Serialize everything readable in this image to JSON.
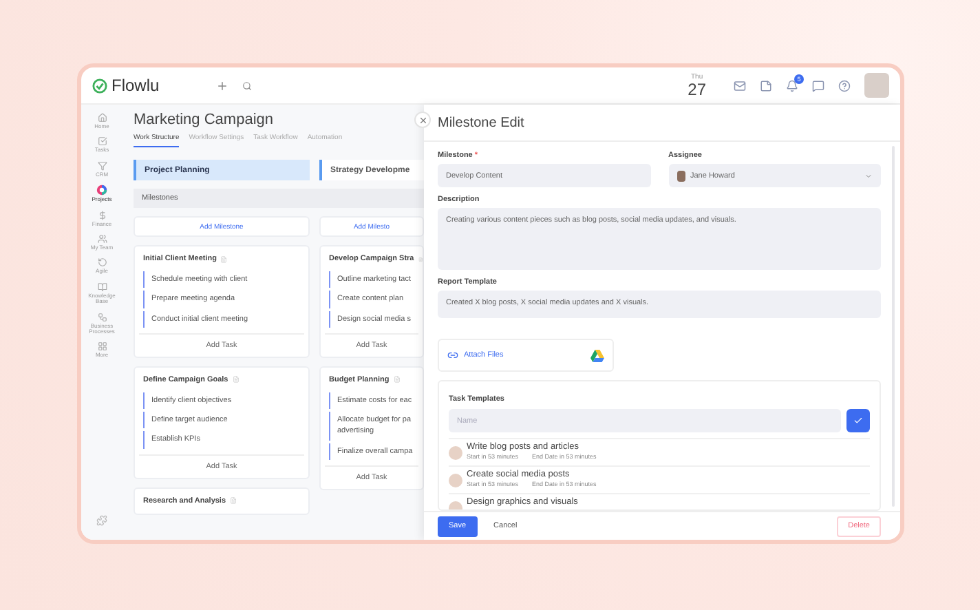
{
  "app": {
    "logo": "Flowlu"
  },
  "date": {
    "weekday": "Thu",
    "day": "27"
  },
  "notifications": {
    "count": "5"
  },
  "sidebar": {
    "items": [
      {
        "label": "Home",
        "selected": false
      },
      {
        "label": "Tasks",
        "selected": false
      },
      {
        "label": "CRM",
        "selected": false
      },
      {
        "label": "Projects",
        "selected": true
      },
      {
        "label": "Finance",
        "selected": false
      },
      {
        "label": "My Team",
        "selected": false
      },
      {
        "label": "Agile",
        "selected": false
      },
      {
        "label": "Knowledge Base",
        "selected": false
      },
      {
        "label": "Business Processes",
        "selected": false
      },
      {
        "label": "More",
        "selected": false
      }
    ]
  },
  "project": {
    "title": "Marketing Campaign",
    "tabs": [
      {
        "label": "Work Structure",
        "selected": true
      },
      {
        "label": "Workflow Settings",
        "selected": false
      },
      {
        "label": "Task Workflow",
        "selected": false
      },
      {
        "label": "Automation",
        "selected": false
      }
    ]
  },
  "board": {
    "milestones_label": "Milestones",
    "stages": [
      {
        "title": "Project Planning",
        "selected": true,
        "add_label": "Add Milestone",
        "milestones": [
          {
            "title": "Initial Client Meeting",
            "tasks": [
              "Schedule meeting with client",
              "Prepare meeting agenda",
              "Conduct initial client meeting"
            ],
            "add_label": "Add Task"
          },
          {
            "title": "Define Campaign Goals",
            "tasks": [
              "Identify client objectives",
              "Define target audience",
              "Establish KPIs"
            ],
            "add_label": "Add Task"
          },
          {
            "title": "Research and Analysis"
          }
        ]
      },
      {
        "title": "Strategy Developme",
        "selected": false,
        "add_label": "Add Milesto",
        "milestones": [
          {
            "title": "Develop Campaign Stra",
            "tasks": [
              "Outline marketing tact",
              "Create content plan",
              "Design social media s"
            ],
            "add_label": "Add Task"
          },
          {
            "title": "Budget Planning",
            "tasks": [
              "Estimate costs for eac",
              "Allocate budget for pa\nadvertising",
              "Finalize overall campa"
            ],
            "add_label": "Add Task"
          }
        ]
      }
    ]
  },
  "panel": {
    "title": "Milestone Edit",
    "milestone": {
      "label": "Milestone",
      "required_mark": "*",
      "value": "Develop Content"
    },
    "assignee": {
      "label": "Assignee",
      "value": "Jane Howard"
    },
    "description": {
      "label": "Description",
      "value": "Creating various content pieces such as blog posts, social media updates, and visuals."
    },
    "report": {
      "label": "Report Template",
      "value": "Created X blog posts, X social media updates and X visuals."
    },
    "attach": {
      "label": "Attach Files"
    },
    "task_templates": {
      "label": "Task Templates",
      "placeholder": "Name",
      "items": [
        {
          "title": "Write blog posts and articles",
          "start": "Start in 53 minutes",
          "end": "End Date in 53 minutes"
        },
        {
          "title": "Create social media posts",
          "start": "Start in 53 minutes",
          "end": "End Date in 53 minutes"
        },
        {
          "title": "Design graphics and visuals"
        }
      ]
    },
    "buttons": {
      "save": "Save",
      "cancel": "Cancel",
      "delete": "Delete"
    }
  }
}
